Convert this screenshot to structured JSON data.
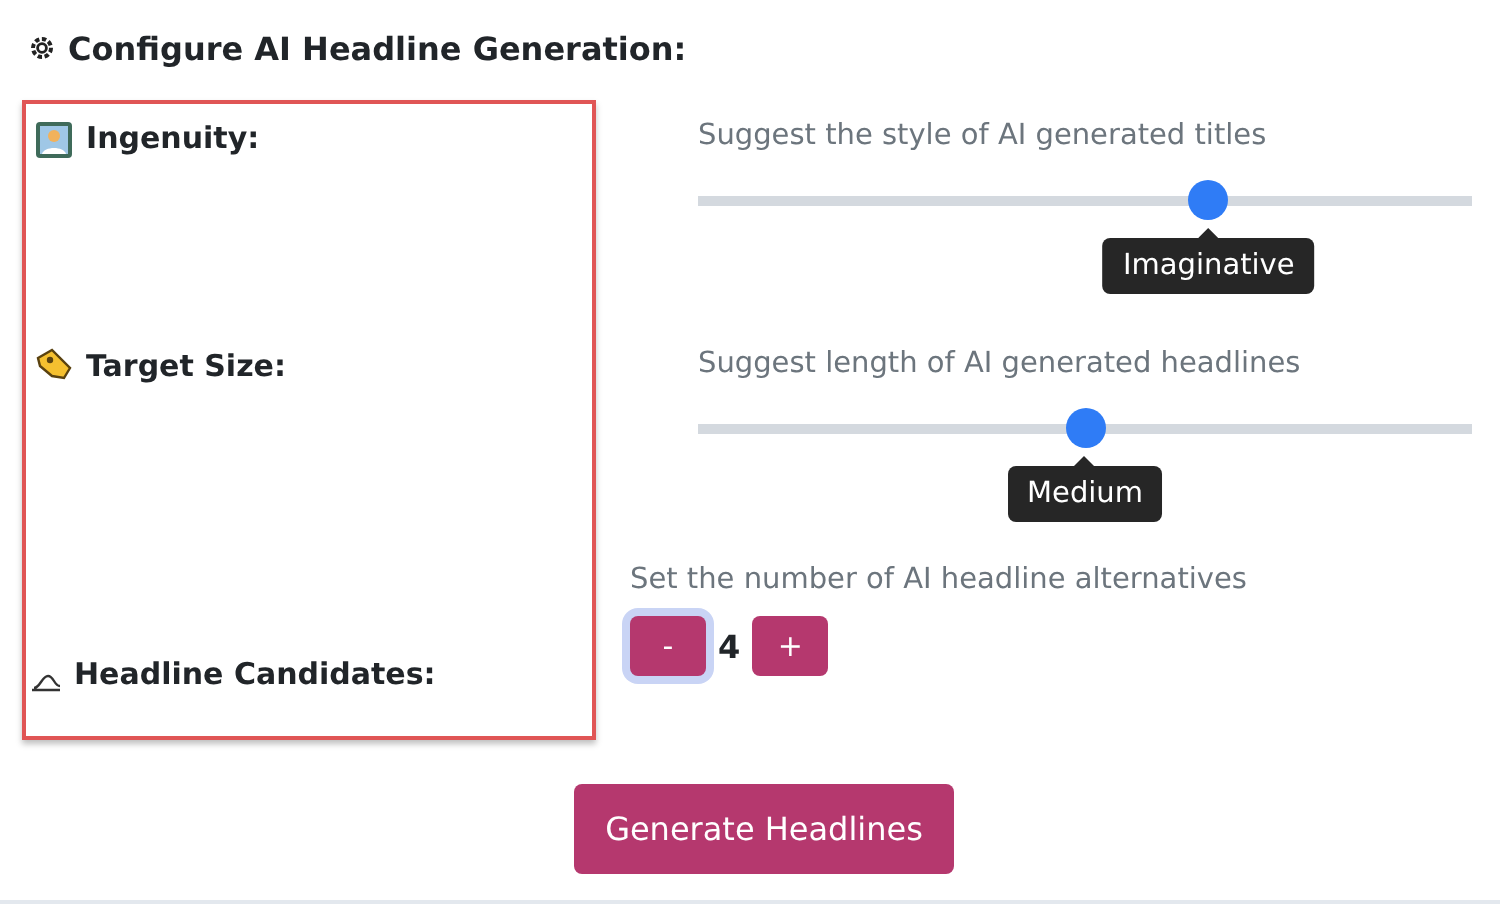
{
  "heading": "Configure AI Headline Generation:",
  "settings": [
    {
      "kind": "slider",
      "label": "Ingenuity:",
      "description": "Suggest the style of AI generated titles",
      "level": 0.66,
      "tooltip": "Imaginative"
    },
    {
      "kind": "slider",
      "label": "Target Size:",
      "description": "Suggest length of AI generated headlines",
      "level": 0.5,
      "tooltip": "Medium"
    },
    {
      "kind": "stepper",
      "label": "Headline Candidates:",
      "description": "Set the number of AI headline alternatives",
      "decrement": "-",
      "value": "4",
      "increment": "+"
    }
  ],
  "generate_button": "Generate Headlines"
}
